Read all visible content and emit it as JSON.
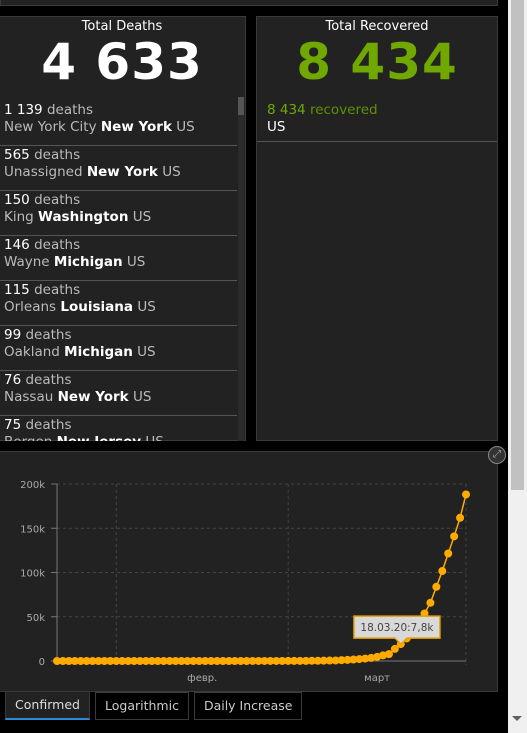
{
  "deaths": {
    "title": "Total Deaths",
    "total": "4 633",
    "items": [
      {
        "count": "1 139",
        "unit": "deaths",
        "place": "New York City",
        "state": "New York",
        "country": "US"
      },
      {
        "count": "565",
        "unit": "deaths",
        "place": "Unassigned",
        "state": "New York",
        "country": "US"
      },
      {
        "count": "150",
        "unit": "deaths",
        "place": "King",
        "state": "Washington",
        "country": "US"
      },
      {
        "count": "146",
        "unit": "deaths",
        "place": "Wayne",
        "state": "Michigan",
        "country": "US"
      },
      {
        "count": "115",
        "unit": "deaths",
        "place": "Orleans",
        "state": "Louisiana",
        "country": "US"
      },
      {
        "count": "99",
        "unit": "deaths",
        "place": "Oakland",
        "state": "Michigan",
        "country": "US"
      },
      {
        "count": "76",
        "unit": "deaths",
        "place": "Nassau",
        "state": "New York",
        "country": "US"
      },
      {
        "count": "75",
        "unit": "deaths",
        "place": "Bergen",
        "state": "New Jersey",
        "country": "US"
      }
    ]
  },
  "recovered": {
    "title": "Total Recovered",
    "total": "8 434",
    "items": [
      {
        "count": "8 434",
        "unit": "recovered",
        "country": "US"
      }
    ]
  },
  "chart_data": {
    "type": "line",
    "title": "",
    "xlabel": "",
    "ylabel": "",
    "series_color": "#ffaa00",
    "x_tick_labels": [
      "февр.",
      "март"
    ],
    "y_tick_labels": [
      "0",
      "50k",
      "100k",
      "150k",
      "200k"
    ],
    "ylim": [
      0,
      200000
    ],
    "x_start": "2020-01-22",
    "x_end": "2020-03-31",
    "grid": true,
    "tooltip": {
      "label": "18.03.20:7,8k",
      "date": "2020-03-18",
      "value": 7800
    },
    "series": [
      {
        "name": "Confirmed",
        "dates_from": "2020-01-22",
        "values": [
          1,
          1,
          2,
          2,
          5,
          5,
          5,
          5,
          5,
          7,
          8,
          8,
          11,
          11,
          11,
          11,
          11,
          11,
          11,
          11,
          12,
          12,
          13,
          13,
          13,
          13,
          13,
          13,
          13,
          13,
          15,
          15,
          15,
          51,
          51,
          57,
          58,
          60,
          68,
          74,
          98,
          118,
          149,
          217,
          262,
          402,
          518,
          583,
          959,
          1281,
          1663,
          2179,
          2727,
          3499,
          4632,
          6421,
          7786,
          13680,
          19101,
          25493,
          33276,
          43847,
          53740,
          65778,
          83836,
          101657,
          121478,
          140886,
          161807,
          188172
        ]
      }
    ]
  },
  "tabs": [
    {
      "label": "Confirmed",
      "active": true
    },
    {
      "label": "Logarithmic",
      "active": false
    },
    {
      "label": "Daily Increase",
      "active": false
    }
  ],
  "icons": {
    "expand": "expand-icon"
  }
}
